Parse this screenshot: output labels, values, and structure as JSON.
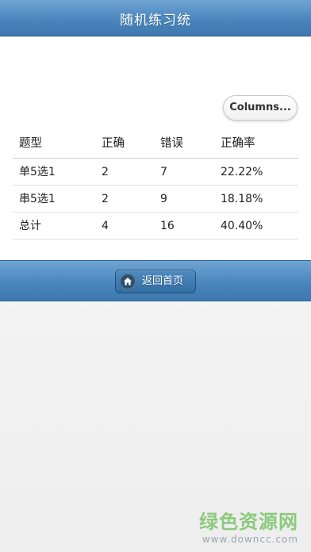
{
  "header": {
    "title": "随机练习统"
  },
  "toolbar": {
    "columns_label": "Columns..."
  },
  "table": {
    "columns": [
      "题型",
      "正确",
      "错误",
      "正确率"
    ],
    "rows": [
      [
        "单5选1",
        "2",
        "7",
        "22.22%"
      ],
      [
        "串5选1",
        "2",
        "9",
        "18.18%"
      ],
      [
        "总计",
        "4",
        "16",
        "40.40%"
      ]
    ]
  },
  "footer": {
    "home_label": "返回首页",
    "home_icon": "home-icon"
  },
  "watermark": {
    "main": "绿色资源网",
    "sub": "www.downcc.com"
  },
  "colors": {
    "bar_blue": "#4a86bd",
    "watermark_green": "#7cc36a"
  }
}
